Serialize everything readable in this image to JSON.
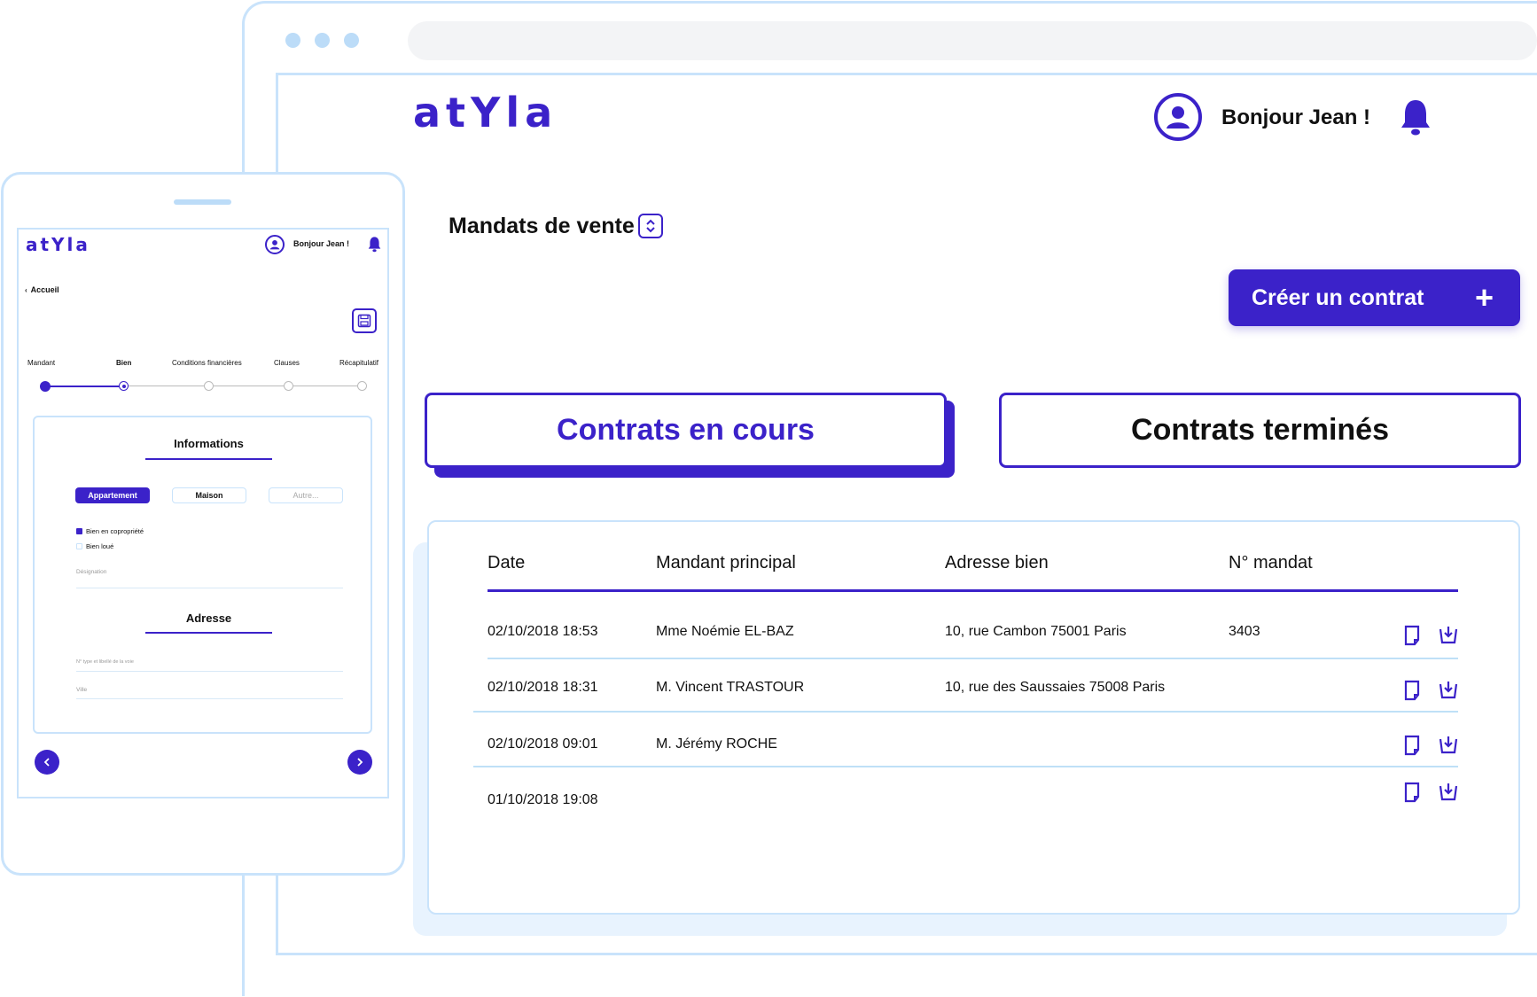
{
  "colors": {
    "accent": "#3b22c9",
    "frame": "#c9e3fb",
    "rowline": "#bfe0f7"
  },
  "desktop": {
    "logo": "atYla",
    "greeting": "Bonjour Jean !",
    "icons": {
      "avatar": "user-circle-icon",
      "notifications": "bell-icon",
      "sort": "sort-arrows-icon",
      "plus": "plus-icon",
      "document": "document-icon",
      "download": "download-icon"
    },
    "page_title": "Mandats de vente",
    "create_button": "Créer un contrat",
    "create_button_icon": "+",
    "tabs": [
      {
        "label": "Contrats en cours",
        "active": true
      },
      {
        "label": "Contrats terminés",
        "active": false
      }
    ],
    "table": {
      "columns": [
        "Date",
        "Mandant principal",
        "Adresse bien",
        "N° mandat"
      ],
      "rows": [
        {
          "date": "02/10/2018 18:53",
          "mandant": "Mme Noémie EL-BAZ",
          "adresse": "10, rue Cambon 75001 Paris",
          "numero": "3403"
        },
        {
          "date": "02/10/2018 18:31",
          "mandant": "M. Vincent TRASTOUR",
          "adresse": "10, rue des Saussaies 75008 Paris",
          "numero": ""
        },
        {
          "date": "02/10/2018 09:01",
          "mandant": "M. Jérémy ROCHE",
          "adresse": "",
          "numero": ""
        },
        {
          "date": "01/10/2018 19:08",
          "mandant": "",
          "adresse": "",
          "numero": ""
        }
      ]
    }
  },
  "tablet": {
    "logo": "atYla",
    "greeting": "Bonjour Jean !",
    "back_link": "Accueil",
    "steps": [
      "Mandant",
      "Bien",
      "Conditions financières",
      "Clauses",
      "Récapitulatif"
    ],
    "active_step": "Bien",
    "section_info": "Informations",
    "property_types": [
      {
        "label": "Appartement",
        "selected": true
      },
      {
        "label": "Maison",
        "selected": false
      },
      {
        "label": "Autre...",
        "selected": false
      }
    ],
    "checkboxes": [
      {
        "label": "Bien en copropriété",
        "checked": true
      },
      {
        "label": "Bien loué",
        "checked": false
      }
    ],
    "designation_placeholder": "Désignation",
    "section_address": "Adresse",
    "street_placeholder": "N° type et libellé de la voie",
    "city_placeholder": "Ville"
  }
}
